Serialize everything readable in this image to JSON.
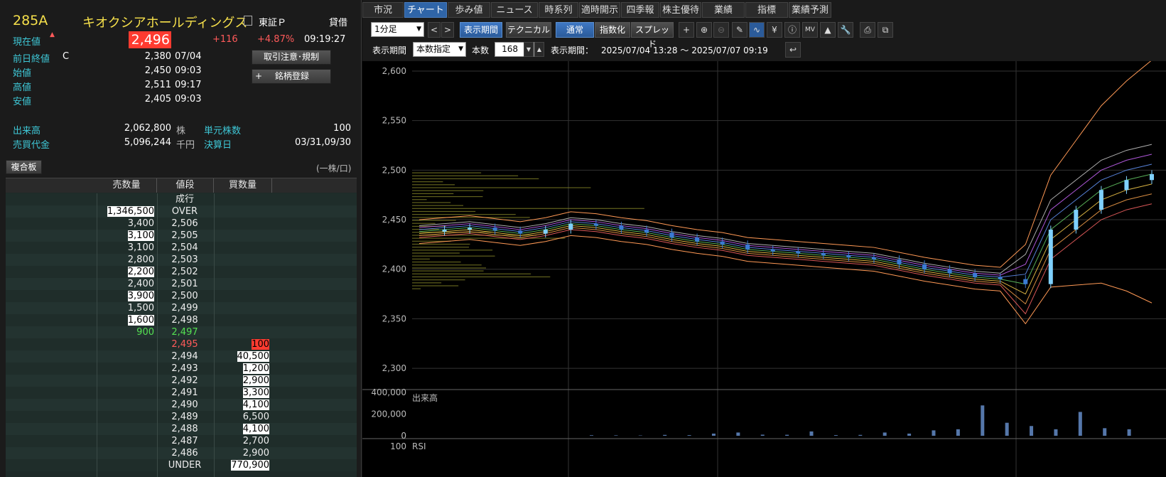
{
  "stock": {
    "code": "285A",
    "name": "キオクシアホールディングス",
    "market": "東証Ｐ",
    "lending": "貸借",
    "current_label": "現在値",
    "current_price": "2,496",
    "change": "+116",
    "change_pct": "+4.87%",
    "time": "09:19:27"
  },
  "quote": [
    {
      "label": "前日終値",
      "flag": "C",
      "value": "2,380",
      "time": "07/04"
    },
    {
      "label": "始値",
      "flag": "",
      "value": "2,450",
      "time": "09:03"
    },
    {
      "label": "高値",
      "flag": "",
      "value": "2,511",
      "time": "09:17"
    },
    {
      "label": "安値",
      "flag": "",
      "value": "2,405",
      "time": "09:03"
    }
  ],
  "buttons": {
    "caution": "取引注意･規制",
    "register": "銘柄登録",
    "register_plus": "+"
  },
  "volume": {
    "label": "出来高",
    "value": "2,062,800",
    "unit": "株",
    "unit_label": "単元株数",
    "unit_value": "100"
  },
  "turnover": {
    "label": "売買代金",
    "value": "5,096,244",
    "unit": "千円",
    "settle_label": "決算日",
    "settle_value": "03/31,09/30"
  },
  "orderbook": {
    "title": "複合板",
    "unit_note": "(一株/口)",
    "headers": [
      "売数量",
      "値段",
      "買数量"
    ],
    "rows": [
      {
        "sell": "",
        "price": "成行",
        "buy": "",
        "sell_hl": "",
        "buy_hl": "",
        "price_color": ""
      },
      {
        "sell": "1,346,500",
        "price": "OVER",
        "buy": "",
        "sell_hl": "white",
        "buy_hl": "",
        "price_color": ""
      },
      {
        "sell": "3,400",
        "price": "2,506",
        "buy": "",
        "sell_hl": "",
        "buy_hl": "",
        "price_color": ""
      },
      {
        "sell": "3,100",
        "price": "2,505",
        "buy": "",
        "sell_hl": "white",
        "buy_hl": "",
        "price_color": ""
      },
      {
        "sell": "3,100",
        "price": "2,504",
        "buy": "",
        "sell_hl": "",
        "buy_hl": "",
        "price_color": ""
      },
      {
        "sell": "2,800",
        "price": "2,503",
        "buy": "",
        "sell_hl": "",
        "buy_hl": "",
        "price_color": ""
      },
      {
        "sell": "2,200",
        "price": "2,502",
        "buy": "",
        "sell_hl": "white",
        "buy_hl": "",
        "price_color": ""
      },
      {
        "sell": "2,400",
        "price": "2,501",
        "buy": "",
        "sell_hl": "",
        "buy_hl": "",
        "price_color": ""
      },
      {
        "sell": "3,900",
        "price": "2,500",
        "buy": "",
        "sell_hl": "white",
        "buy_hl": "",
        "price_color": ""
      },
      {
        "sell": "1,500",
        "price": "2,499",
        "buy": "",
        "sell_hl": "",
        "buy_hl": "",
        "price_color": ""
      },
      {
        "sell": "1,600",
        "price": "2,498",
        "buy": "",
        "sell_hl": "white",
        "buy_hl": "",
        "price_color": ""
      },
      {
        "sell": "900",
        "price": "2,497",
        "buy": "",
        "sell_hl": "green",
        "buy_hl": "",
        "price_color": "green"
      },
      {
        "sell": "",
        "price": "2,495",
        "buy": "100",
        "sell_hl": "",
        "buy_hl": "red",
        "price_color": "red"
      },
      {
        "sell": "",
        "price": "2,494",
        "buy": "40,500",
        "sell_hl": "",
        "buy_hl": "white",
        "price_color": ""
      },
      {
        "sell": "",
        "price": "2,493",
        "buy": "1,200",
        "sell_hl": "",
        "buy_hl": "white",
        "price_color": ""
      },
      {
        "sell": "",
        "price": "2,492",
        "buy": "2,900",
        "sell_hl": "",
        "buy_hl": "white",
        "price_color": ""
      },
      {
        "sell": "",
        "price": "2,491",
        "buy": "3,300",
        "sell_hl": "",
        "buy_hl": "white",
        "price_color": ""
      },
      {
        "sell": "",
        "price": "2,490",
        "buy": "4,100",
        "sell_hl": "",
        "buy_hl": "white",
        "price_color": ""
      },
      {
        "sell": "",
        "price": "2,489",
        "buy": "6,500",
        "sell_hl": "",
        "buy_hl": "",
        "price_color": ""
      },
      {
        "sell": "",
        "price": "2,488",
        "buy": "4,100",
        "sell_hl": "",
        "buy_hl": "white",
        "price_color": ""
      },
      {
        "sell": "",
        "price": "2,487",
        "buy": "2,700",
        "sell_hl": "",
        "buy_hl": "",
        "price_color": ""
      },
      {
        "sell": "",
        "price": "2,486",
        "buy": "2,900",
        "sell_hl": "",
        "buy_hl": "",
        "price_color": ""
      },
      {
        "sell": "",
        "price": "UNDER",
        "buy": "770,900",
        "sell_hl": "",
        "buy_hl": "white",
        "price_color": ""
      }
    ]
  },
  "tabs": [
    "市況",
    "チャート",
    "歩み値",
    "ニュース",
    "時系列",
    "適時開示",
    "四季報",
    "株主優待",
    "業績",
    "指標",
    "業績予測"
  ],
  "active_tab": 1,
  "toolbar": {
    "interval": "1分足",
    "period_btn": "表示期間",
    "technical_btn": "テクニカル",
    "normal_btn": "通常",
    "index_btn": "指数化",
    "spread_btn": "スプレッド"
  },
  "toolbar2": {
    "period_label": "表示期間",
    "period_mode": "本数指定",
    "count_label": "本数",
    "count_value": "168",
    "range_label": "表示期間：",
    "range_value": "2025/07/04 13:28 ～ 2025/07/07 09:19"
  },
  "colors": {
    "up_candle": "#7fd1ff",
    "down_candle": "#3a7bd5",
    "volume_bar": "#5577aa"
  },
  "chart_data": [
    {
      "type": "line",
      "title": "",
      "ylim": [
        2280,
        2610
      ],
      "y_ticks": [
        "2,600",
        "2,550",
        "2,500",
        "2,450",
        "2,400",
        "2,350",
        "2,300"
      ],
      "series": [
        {
          "values": [
            2438,
            2440,
            2442,
            2439,
            2436,
            2440,
            2446,
            2444,
            2440,
            2437,
            2432,
            2428,
            2425,
            2420,
            2418,
            2416,
            2414,
            2412,
            2410,
            2405,
            2400,
            2396,
            2392,
            2390,
            2385,
            2440,
            2460,
            2480,
            2490,
            2496
          ]
        }
      ]
    },
    {
      "type": "bar",
      "title": "出来高",
      "ylim": [
        0,
        400000
      ],
      "y_ticks": [
        "400,000",
        "200,000",
        "0"
      ],
      "values": [
        5000,
        4000,
        3000,
        8000,
        6000,
        20000,
        30000,
        10000,
        9000,
        40000,
        6000,
        8000,
        30000,
        20000,
        50000,
        60000,
        280000,
        120000,
        90000,
        60000,
        220000,
        70000,
        60000
      ]
    },
    {
      "type": "line",
      "title": "RSI",
      "y_ticks": [
        "100"
      ]
    }
  ]
}
